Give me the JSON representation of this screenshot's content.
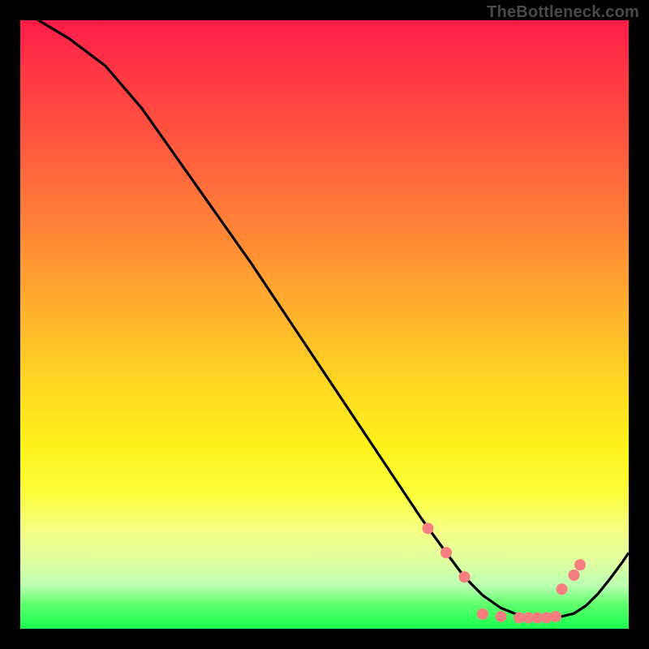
{
  "watermark": "TheBottleneck.com",
  "colors": {
    "background": "#000000",
    "curve": "#000000",
    "marker_fill": "#f77e7e",
    "marker_stroke": "#f77e7e"
  },
  "chart_data": {
    "type": "line",
    "title": "",
    "xlabel": "",
    "ylabel": "",
    "xlim": [
      0,
      100
    ],
    "ylim": [
      0,
      100
    ],
    "curve": {
      "x": [
        0,
        3,
        8,
        14,
        20,
        26,
        32,
        38,
        44,
        50,
        56,
        62,
        66,
        70,
        73,
        76,
        79,
        82,
        85,
        88,
        91,
        93,
        95,
        97,
        99,
        100
      ],
      "y": [
        102,
        100,
        97,
        92.5,
        85.5,
        77,
        68.5,
        60,
        51,
        42,
        33,
        24,
        18,
        12.5,
        8.5,
        5.5,
        3.4,
        2.2,
        1.8,
        1.8,
        2.5,
        3.8,
        5.8,
        8.3,
        11,
        12.5
      ]
    },
    "markers": {
      "x": [
        67,
        70,
        73,
        76,
        79,
        82,
        83.5,
        85,
        86.5,
        88,
        89,
        91,
        92
      ],
      "y": [
        16.5,
        12.5,
        8.5,
        2.4,
        2.0,
        1.8,
        1.8,
        1.8,
        1.8,
        2.0,
        6.5,
        8.8,
        10.5
      ]
    }
  }
}
